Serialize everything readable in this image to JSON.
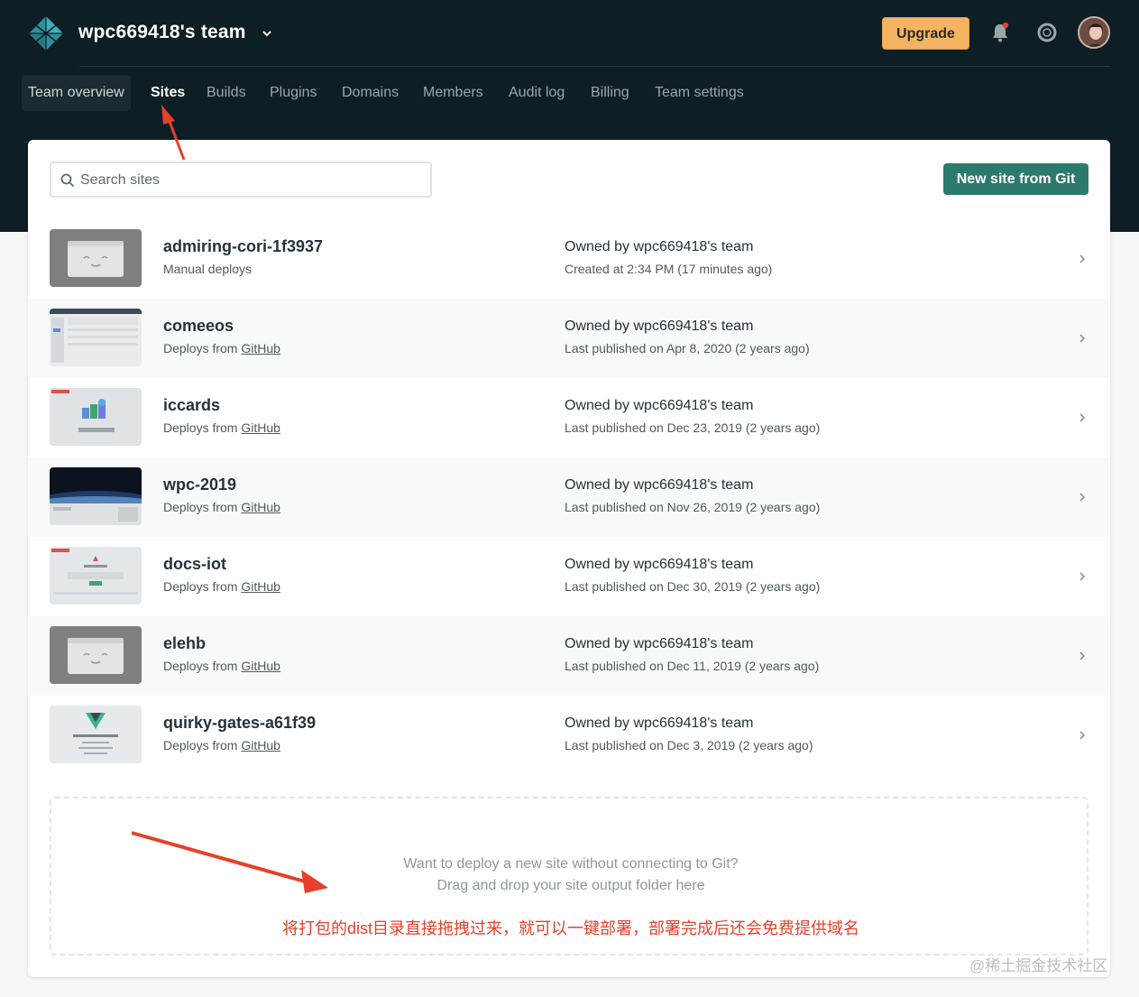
{
  "header": {
    "team_name": "wpc669418's team",
    "upgrade_label": "Upgrade",
    "colors": {
      "topbar": "#0e1e25",
      "upgrade": "#f4b462",
      "accent": "#2c7a6e",
      "annotation": "#e5412b"
    }
  },
  "nav": {
    "items": [
      {
        "label": "Team overview"
      },
      {
        "label": "Sites"
      },
      {
        "label": "Builds"
      },
      {
        "label": "Plugins"
      },
      {
        "label": "Domains"
      },
      {
        "label": "Members"
      },
      {
        "label": "Audit log"
      },
      {
        "label": "Billing"
      },
      {
        "label": "Team settings"
      }
    ],
    "active": "Sites"
  },
  "search": {
    "placeholder": "Search sites",
    "value": ""
  },
  "new_site_label": "New site from Git",
  "sites": [
    {
      "name": "admiring-cori-1f3937",
      "deploy_text": "Manual deploys",
      "deploy_link": "",
      "owner": "Owned by wpc669418's team",
      "published": "Created at 2:34 PM (17 minutes ago)",
      "thumb": "placeholder"
    },
    {
      "name": "comeeos",
      "deploy_text": "Deploys from ",
      "deploy_link": "GitHub",
      "owner": "Owned by wpc669418's team",
      "published": "Last published on Apr 8, 2020 (2 years ago)",
      "thumb": "app-screenshot"
    },
    {
      "name": "iccards",
      "deploy_text": "Deploys from ",
      "deploy_link": "GitHub",
      "owner": "Owned by wpc669418's team",
      "published": "Last published on Dec 23, 2019 (2 years ago)",
      "thumb": "cards-screenshot"
    },
    {
      "name": "wpc-2019",
      "deploy_text": "Deploys from ",
      "deploy_link": "GitHub",
      "owner": "Owned by wpc669418's team",
      "published": "Last published on Nov 26, 2019 (2 years ago)",
      "thumb": "earth-screenshot"
    },
    {
      "name": "docs-iot",
      "deploy_text": "Deploys from ",
      "deploy_link": "GitHub",
      "owner": "Owned by wpc669418's team",
      "published": "Last published on Dec 30, 2019 (2 years ago)",
      "thumb": "docs-screenshot"
    },
    {
      "name": "elehb",
      "deploy_text": "Deploys from ",
      "deploy_link": "GitHub",
      "owner": "Owned by wpc669418's team",
      "published": "Last published on Dec 11, 2019 (2 years ago)",
      "thumb": "placeholder"
    },
    {
      "name": "quirky-gates-a61f39",
      "deploy_text": "Deploys from ",
      "deploy_link": "GitHub",
      "owner": "Owned by wpc669418's team",
      "published": "Last published on Dec 3, 2019 (2 years ago)",
      "thumb": "vue-screenshot"
    }
  ],
  "dropzone": {
    "line1": "Want to deploy a new site without connecting to Git?",
    "line2": "Drag and drop your site output folder here",
    "annotation": "将打包的dist目录直接拖拽过来，就可以一键部署，部署完成后还会免费提供域名"
  },
  "watermark": "@稀土掘金技术社区",
  "icons": [
    "netlify-logo-icon",
    "caret-down-icon",
    "bell-icon",
    "lifebuoy-icon",
    "search-icon",
    "chevron-right-icon"
  ]
}
